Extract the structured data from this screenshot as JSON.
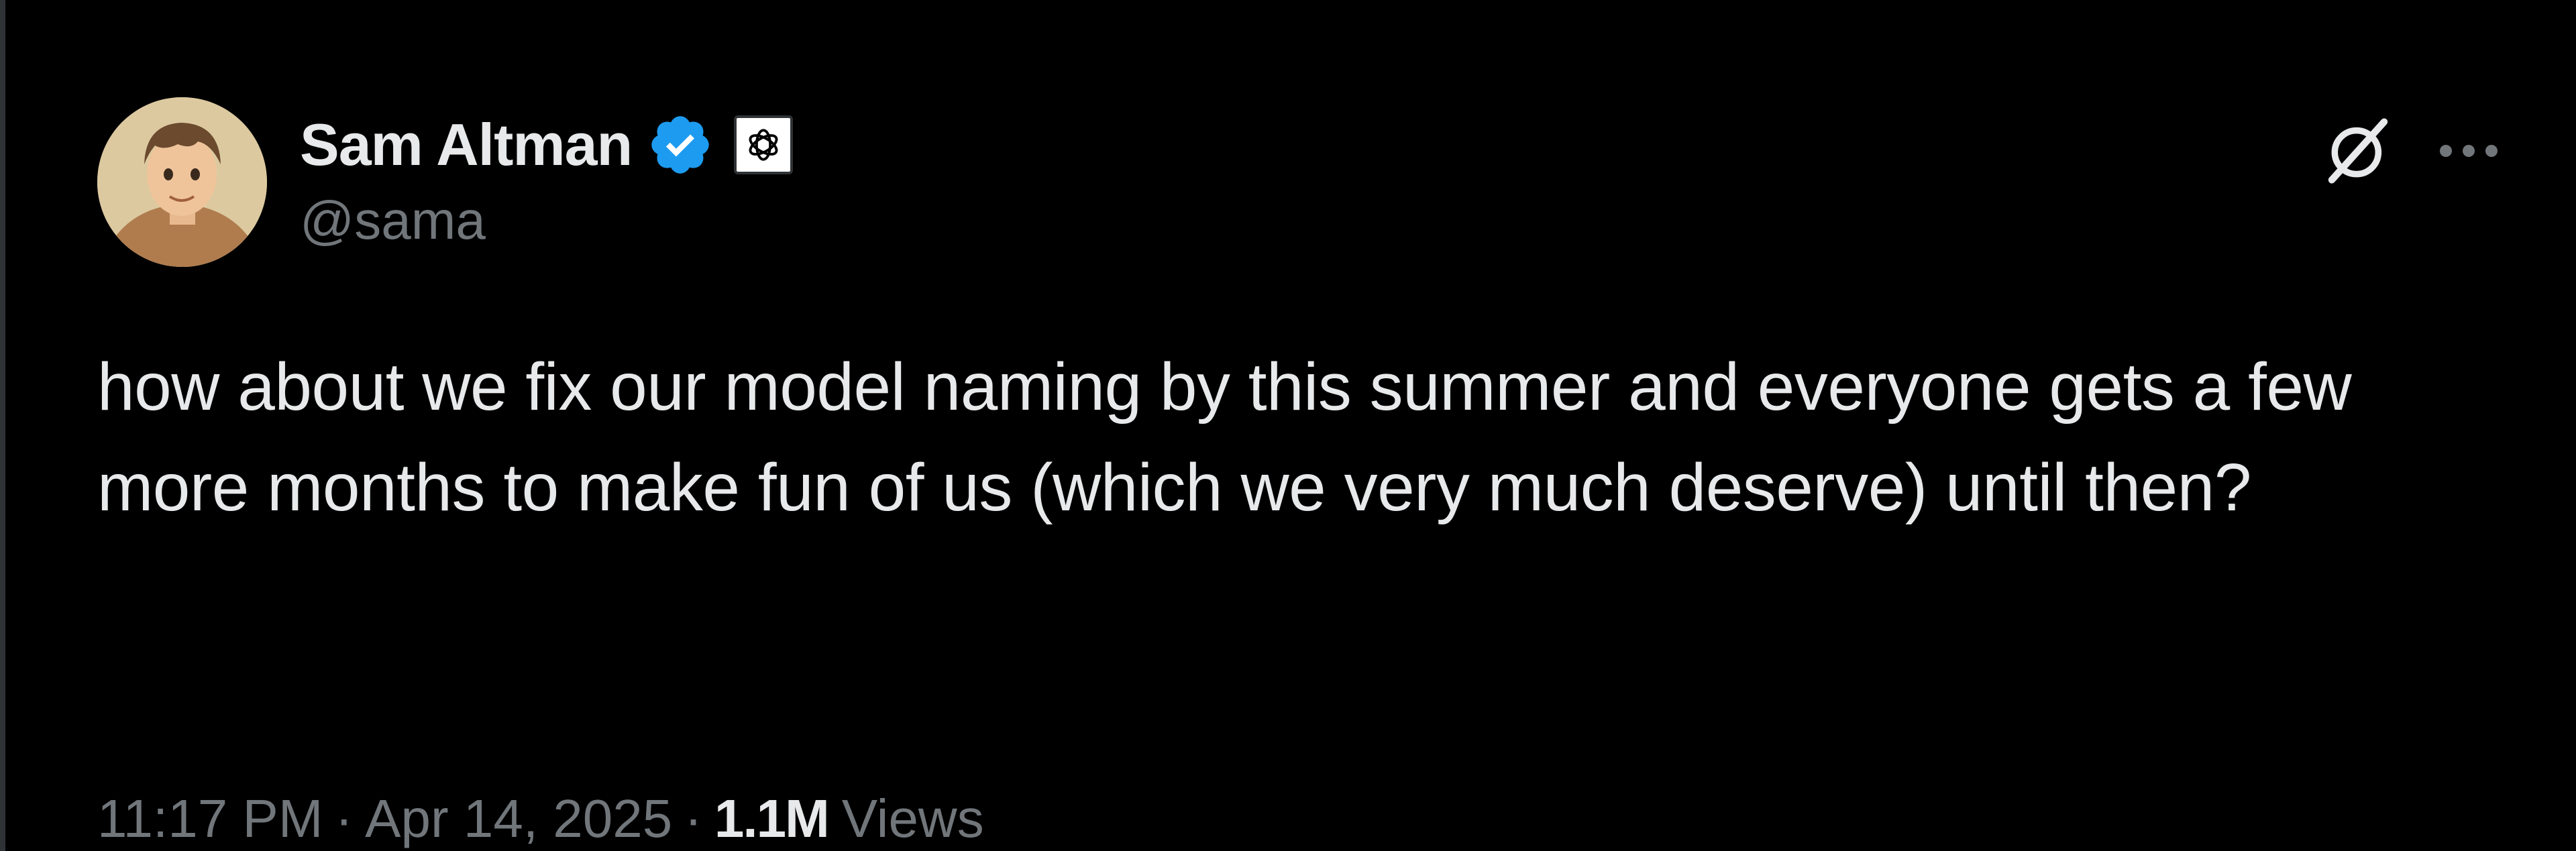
{
  "tweet": {
    "author": {
      "display_name": "Sam Altman",
      "handle": "@sama",
      "verified_icon": "verified-badge-icon",
      "affiliation_icon": "openai-logo-icon"
    },
    "text": "how about we fix our model naming by this summer and everyone gets a few more months to make fun of us (which we very much deserve) until then?",
    "time": "11:17 PM",
    "date": "Apr 14, 2025",
    "views_count": "1.1M",
    "views_label": "Views",
    "separator": "·"
  },
  "actions": {
    "grok_icon": "grok-icon",
    "more_icon": "more-options-icon"
  },
  "colors": {
    "background": "#000000",
    "primary_text": "#e7e9ea",
    "secondary_text": "#71767b",
    "verified_blue": "#1d9bf0"
  }
}
